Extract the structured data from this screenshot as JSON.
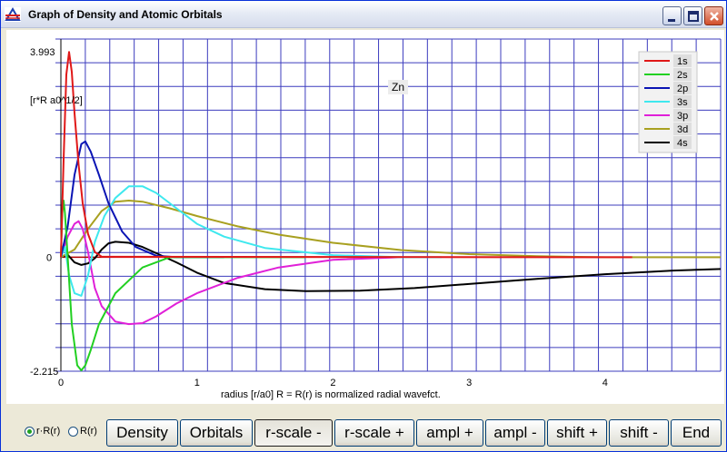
{
  "window": {
    "title": "Graph of Density and Atomic Orbitals"
  },
  "colors": {
    "grid": "#3c3cbe",
    "zero_line": "#b30000",
    "1s": "#e01818",
    "2s": "#22d022",
    "2p": "#0a14b4",
    "3s": "#3ee8ee",
    "3p": "#e020d8",
    "3d": "#a8a020",
    "4s": "#000000"
  },
  "plot": {
    "element_label": "Zn",
    "y_axis_label": "[r*R a0^1/2]",
    "x_axis_label": "radius [r/a0]   R = R(r) is normalized radial wavefct.",
    "y_max_label": "3.993",
    "y_zero_label": "0",
    "y_min_label": "-2.215"
  },
  "legend": [
    "1s",
    "2s",
    "2p",
    "3s",
    "3p",
    "3d",
    "4s"
  ],
  "controls": {
    "radio_rR_label": "r·R(r)",
    "radio_R_label": "R(r)",
    "density_button": "Density",
    "orbitals_button": "Orbitals",
    "r_scale_minus_button": "r-scale -",
    "r_scale_plus_button": "r-scale +",
    "ampl_plus_button": "ampl +",
    "ampl_minus_button": "ampl -",
    "shift_plus_button": "shift +",
    "shift_minus_button": "shift -",
    "end_button": "End"
  },
  "chart_data": {
    "type": "line",
    "title": "",
    "xlabel": "radius [r/a0]   R = R(r) is normalized radial wavefct.",
    "ylabel": "[r*R a0^1/2]",
    "xlim": [
      0,
      4.85
    ],
    "ylim": [
      -2.215,
      3.993
    ],
    "x_ticks": [
      "0",
      "1",
      "2",
      "3",
      "4"
    ],
    "y_tick_labels": [
      "3.993",
      "0",
      "-2.215"
    ],
    "grid": true,
    "legend_position": "top-right",
    "series": [
      {
        "name": "1s",
        "x": [
          0,
          0.02,
          0.04,
          0.06,
          0.08,
          0.1,
          0.13,
          0.16,
          0.2,
          0.25,
          0.3,
          4.2
        ],
        "y": [
          0,
          1.9,
          3.55,
          3.99,
          3.6,
          2.8,
          1.8,
          1.05,
          0.45,
          0.1,
          0.01,
          0.0
        ]
      },
      {
        "name": "2s",
        "x": [
          0,
          0.01,
          0.02,
          0.03,
          0.05,
          0.08,
          0.12,
          0.15,
          0.18,
          0.22,
          0.28,
          0.4,
          0.6,
          0.8,
          1.0,
          1.3,
          1.8
        ],
        "y": [
          0,
          0.85,
          1.1,
          0.85,
          0.0,
          -1.3,
          -2.1,
          -2.2,
          -2.1,
          -1.8,
          -1.3,
          -0.7,
          -0.2,
          0.0,
          0.0,
          0.0,
          0.0
        ]
      },
      {
        "name": "2p",
        "x": [
          0,
          0.05,
          0.1,
          0.15,
          0.18,
          0.22,
          0.28,
          0.35,
          0.45,
          0.55,
          0.7,
          0.85,
          1.0,
          1.2
        ],
        "y": [
          0,
          0.6,
          1.6,
          2.2,
          2.25,
          2.05,
          1.6,
          1.05,
          0.5,
          0.2,
          0.03,
          0.0,
          0.0,
          0.0
        ]
      },
      {
        "name": "3s",
        "x": [
          0,
          0.03,
          0.06,
          0.1,
          0.15,
          0.2,
          0.25,
          0.32,
          0.4,
          0.5,
          0.6,
          0.7,
          0.85,
          1.0,
          1.2,
          1.5,
          2.0,
          2.5,
          2.8
        ],
        "y": [
          0,
          0.2,
          -0.35,
          -0.7,
          -0.75,
          -0.35,
          0.3,
          0.8,
          1.15,
          1.38,
          1.38,
          1.25,
          0.95,
          0.65,
          0.4,
          0.18,
          0.04,
          0.0,
          0.0
        ]
      },
      {
        "name": "3p",
        "x": [
          0,
          0.05,
          0.1,
          0.13,
          0.16,
          0.2,
          0.25,
          0.3,
          0.4,
          0.5,
          0.6,
          0.7,
          0.85,
          1.0,
          1.3,
          1.6,
          2.0,
          2.5
        ],
        "y": [
          0,
          0.4,
          0.65,
          0.7,
          0.55,
          0.1,
          -0.6,
          -0.95,
          -1.25,
          -1.3,
          -1.28,
          -1.15,
          -0.9,
          -0.7,
          -0.4,
          -0.2,
          -0.05,
          0.0
        ]
      },
      {
        "name": "3d",
        "x": [
          0,
          0.1,
          0.2,
          0.3,
          0.4,
          0.5,
          0.6,
          0.8,
          1.0,
          1.3,
          1.6,
          2.0,
          2.5,
          3.0,
          3.5,
          4.0,
          4.85
        ],
        "y": [
          0,
          0.15,
          0.55,
          0.9,
          1.08,
          1.1,
          1.08,
          0.95,
          0.8,
          0.6,
          0.44,
          0.28,
          0.14,
          0.06,
          0.02,
          0.0,
          0.0
        ]
      },
      {
        "name": "4s",
        "x": [
          0,
          0.05,
          0.1,
          0.15,
          0.2,
          0.25,
          0.3,
          0.35,
          0.4,
          0.5,
          0.6,
          0.7,
          0.85,
          1.0,
          1.2,
          1.5,
          1.8,
          2.2,
          2.6,
          3.0,
          3.5,
          4.0,
          4.5,
          4.85
        ],
        "y": [
          0,
          0.05,
          -0.1,
          -0.15,
          -0.12,
          -0.02,
          0.15,
          0.27,
          0.3,
          0.28,
          0.2,
          0.08,
          -0.1,
          -0.3,
          -0.5,
          -0.62,
          -0.66,
          -0.65,
          -0.6,
          -0.52,
          -0.42,
          -0.33,
          -0.26,
          -0.23
        ]
      }
    ]
  }
}
